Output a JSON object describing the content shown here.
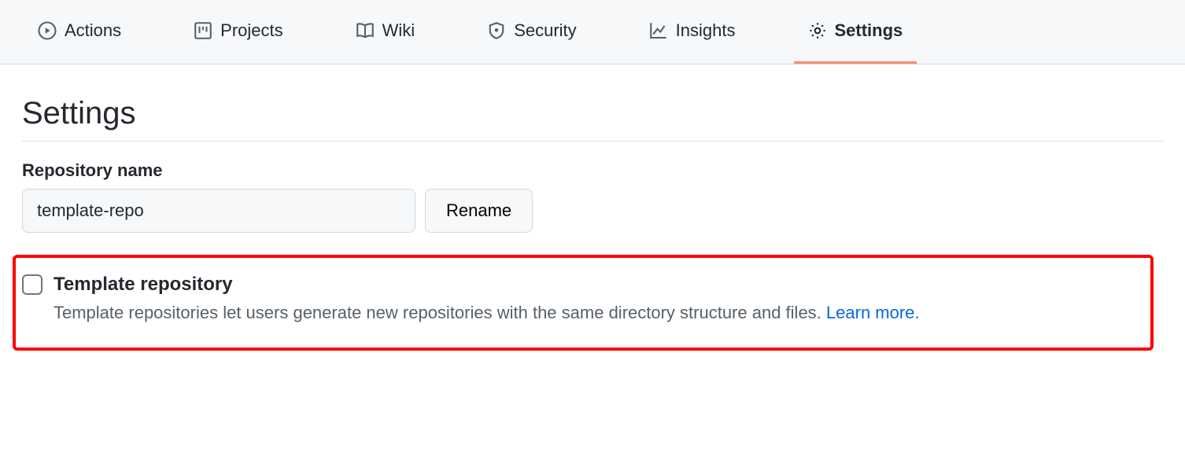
{
  "tabs": [
    {
      "label": "Actions"
    },
    {
      "label": "Projects"
    },
    {
      "label": "Wiki"
    },
    {
      "label": "Security"
    },
    {
      "label": "Insights"
    },
    {
      "label": "Settings"
    }
  ],
  "page": {
    "title": "Settings"
  },
  "repoName": {
    "label": "Repository name",
    "value": "template-repo",
    "renameButton": "Rename"
  },
  "templateRepo": {
    "label": "Template repository",
    "description": "Template repositories let users generate new repositories with the same directory structure and files. ",
    "learnMore": "Learn more.",
    "checked": false
  }
}
